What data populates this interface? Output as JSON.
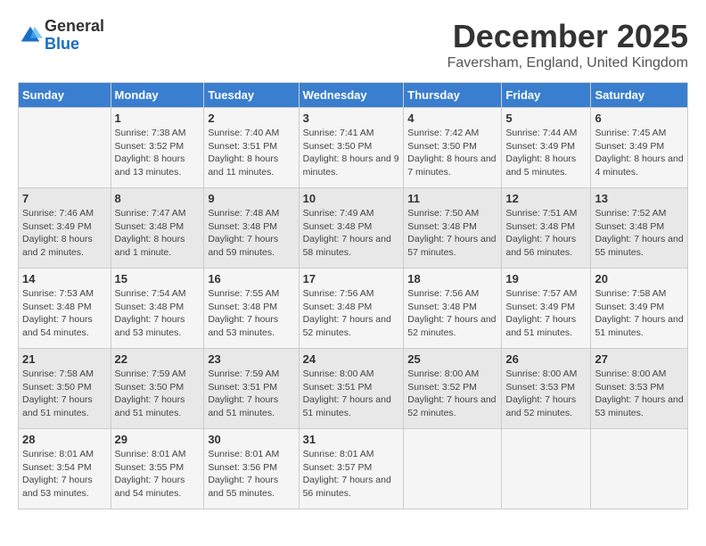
{
  "header": {
    "logo_line1": "General",
    "logo_line2": "Blue",
    "month_title": "December 2025",
    "location": "Faversham, England, United Kingdom"
  },
  "columns": [
    "Sunday",
    "Monday",
    "Tuesday",
    "Wednesday",
    "Thursday",
    "Friday",
    "Saturday"
  ],
  "weeks": [
    [
      {
        "day": "",
        "sunrise": "",
        "sunset": "",
        "daylight": ""
      },
      {
        "day": "1",
        "sunrise": "Sunrise: 7:38 AM",
        "sunset": "Sunset: 3:52 PM",
        "daylight": "Daylight: 8 hours and 13 minutes."
      },
      {
        "day": "2",
        "sunrise": "Sunrise: 7:40 AM",
        "sunset": "Sunset: 3:51 PM",
        "daylight": "Daylight: 8 hours and 11 minutes."
      },
      {
        "day": "3",
        "sunrise": "Sunrise: 7:41 AM",
        "sunset": "Sunset: 3:50 PM",
        "daylight": "Daylight: 8 hours and 9 minutes."
      },
      {
        "day": "4",
        "sunrise": "Sunrise: 7:42 AM",
        "sunset": "Sunset: 3:50 PM",
        "daylight": "Daylight: 8 hours and 7 minutes."
      },
      {
        "day": "5",
        "sunrise": "Sunrise: 7:44 AM",
        "sunset": "Sunset: 3:49 PM",
        "daylight": "Daylight: 8 hours and 5 minutes."
      },
      {
        "day": "6",
        "sunrise": "Sunrise: 7:45 AM",
        "sunset": "Sunset: 3:49 PM",
        "daylight": "Daylight: 8 hours and 4 minutes."
      }
    ],
    [
      {
        "day": "7",
        "sunrise": "Sunrise: 7:46 AM",
        "sunset": "Sunset: 3:49 PM",
        "daylight": "Daylight: 8 hours and 2 minutes."
      },
      {
        "day": "8",
        "sunrise": "Sunrise: 7:47 AM",
        "sunset": "Sunset: 3:48 PM",
        "daylight": "Daylight: 8 hours and 1 minute."
      },
      {
        "day": "9",
        "sunrise": "Sunrise: 7:48 AM",
        "sunset": "Sunset: 3:48 PM",
        "daylight": "Daylight: 7 hours and 59 minutes."
      },
      {
        "day": "10",
        "sunrise": "Sunrise: 7:49 AM",
        "sunset": "Sunset: 3:48 PM",
        "daylight": "Daylight: 7 hours and 58 minutes."
      },
      {
        "day": "11",
        "sunrise": "Sunrise: 7:50 AM",
        "sunset": "Sunset: 3:48 PM",
        "daylight": "Daylight: 7 hours and 57 minutes."
      },
      {
        "day": "12",
        "sunrise": "Sunrise: 7:51 AM",
        "sunset": "Sunset: 3:48 PM",
        "daylight": "Daylight: 7 hours and 56 minutes."
      },
      {
        "day": "13",
        "sunrise": "Sunrise: 7:52 AM",
        "sunset": "Sunset: 3:48 PM",
        "daylight": "Daylight: 7 hours and 55 minutes."
      }
    ],
    [
      {
        "day": "14",
        "sunrise": "Sunrise: 7:53 AM",
        "sunset": "Sunset: 3:48 PM",
        "daylight": "Daylight: 7 hours and 54 minutes."
      },
      {
        "day": "15",
        "sunrise": "Sunrise: 7:54 AM",
        "sunset": "Sunset: 3:48 PM",
        "daylight": "Daylight: 7 hours and 53 minutes."
      },
      {
        "day": "16",
        "sunrise": "Sunrise: 7:55 AM",
        "sunset": "Sunset: 3:48 PM",
        "daylight": "Daylight: 7 hours and 53 minutes."
      },
      {
        "day": "17",
        "sunrise": "Sunrise: 7:56 AM",
        "sunset": "Sunset: 3:48 PM",
        "daylight": "Daylight: 7 hours and 52 minutes."
      },
      {
        "day": "18",
        "sunrise": "Sunrise: 7:56 AM",
        "sunset": "Sunset: 3:48 PM",
        "daylight": "Daylight: 7 hours and 52 minutes."
      },
      {
        "day": "19",
        "sunrise": "Sunrise: 7:57 AM",
        "sunset": "Sunset: 3:49 PM",
        "daylight": "Daylight: 7 hours and 51 minutes."
      },
      {
        "day": "20",
        "sunrise": "Sunrise: 7:58 AM",
        "sunset": "Sunset: 3:49 PM",
        "daylight": "Daylight: 7 hours and 51 minutes."
      }
    ],
    [
      {
        "day": "21",
        "sunrise": "Sunrise: 7:58 AM",
        "sunset": "Sunset: 3:50 PM",
        "daylight": "Daylight: 7 hours and 51 minutes."
      },
      {
        "day": "22",
        "sunrise": "Sunrise: 7:59 AM",
        "sunset": "Sunset: 3:50 PM",
        "daylight": "Daylight: 7 hours and 51 minutes."
      },
      {
        "day": "23",
        "sunrise": "Sunrise: 7:59 AM",
        "sunset": "Sunset: 3:51 PM",
        "daylight": "Daylight: 7 hours and 51 minutes."
      },
      {
        "day": "24",
        "sunrise": "Sunrise: 8:00 AM",
        "sunset": "Sunset: 3:51 PM",
        "daylight": "Daylight: 7 hours and 51 minutes."
      },
      {
        "day": "25",
        "sunrise": "Sunrise: 8:00 AM",
        "sunset": "Sunset: 3:52 PM",
        "daylight": "Daylight: 7 hours and 52 minutes."
      },
      {
        "day": "26",
        "sunrise": "Sunrise: 8:00 AM",
        "sunset": "Sunset: 3:53 PM",
        "daylight": "Daylight: 7 hours and 52 minutes."
      },
      {
        "day": "27",
        "sunrise": "Sunrise: 8:00 AM",
        "sunset": "Sunset: 3:53 PM",
        "daylight": "Daylight: 7 hours and 53 minutes."
      }
    ],
    [
      {
        "day": "28",
        "sunrise": "Sunrise: 8:01 AM",
        "sunset": "Sunset: 3:54 PM",
        "daylight": "Daylight: 7 hours and 53 minutes."
      },
      {
        "day": "29",
        "sunrise": "Sunrise: 8:01 AM",
        "sunset": "Sunset: 3:55 PM",
        "daylight": "Daylight: 7 hours and 54 minutes."
      },
      {
        "day": "30",
        "sunrise": "Sunrise: 8:01 AM",
        "sunset": "Sunset: 3:56 PM",
        "daylight": "Daylight: 7 hours and 55 minutes."
      },
      {
        "day": "31",
        "sunrise": "Sunrise: 8:01 AM",
        "sunset": "Sunset: 3:57 PM",
        "daylight": "Daylight: 7 hours and 56 minutes."
      },
      {
        "day": "",
        "sunrise": "",
        "sunset": "",
        "daylight": ""
      },
      {
        "day": "",
        "sunrise": "",
        "sunset": "",
        "daylight": ""
      },
      {
        "day": "",
        "sunrise": "",
        "sunset": "",
        "daylight": ""
      }
    ]
  ]
}
